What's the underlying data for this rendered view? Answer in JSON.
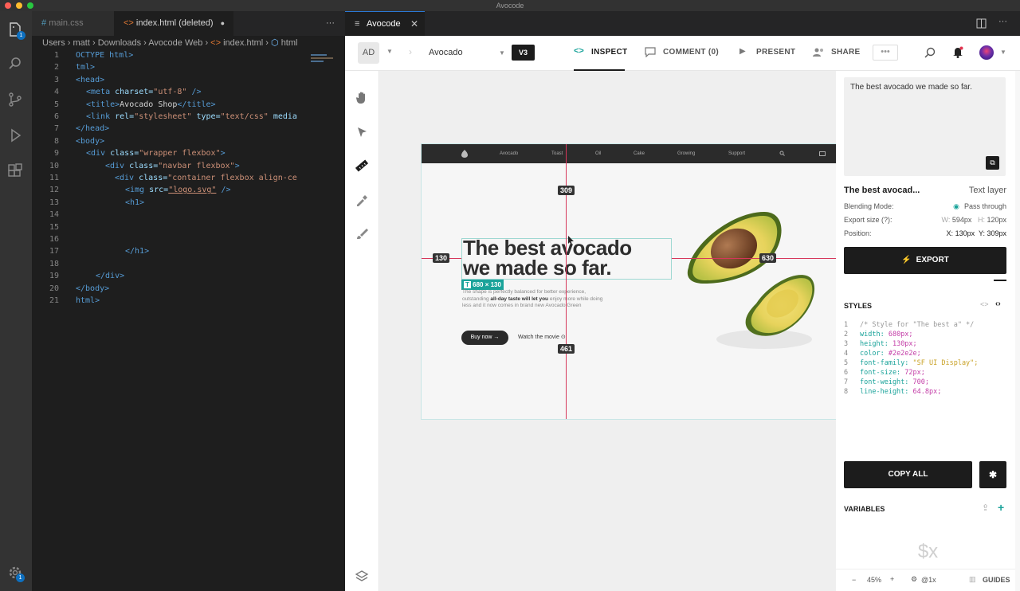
{
  "window": {
    "title": "Avocode"
  },
  "activity": {
    "explorer_badge": "1",
    "settings_badge": "1"
  },
  "editor": {
    "tabs": [
      {
        "label": "main.css"
      },
      {
        "label": "index.html (deleted)"
      }
    ],
    "more": "···",
    "breadcrumb": [
      "Users",
      "matt",
      "Downloads",
      "Avocode Web",
      "index.html",
      "html"
    ],
    "line_numbers": [
      "1",
      "2",
      "3",
      "4",
      "5",
      "6",
      "7",
      "8",
      "9",
      "10",
      "11",
      "12",
      "13",
      "14",
      "15",
      "16",
      "17",
      "18",
      "19",
      "20",
      "21"
    ],
    "code": {
      "l1": "OCTYPE html>",
      "l2": "tml>",
      "l3": "<head>",
      "l4_a": "<meta ",
      "l4_b": "charset=",
      "l4_c": "\"utf-8\"",
      "l4_d": " />",
      "l5_a": "<title>",
      "l5_b": "Avocado Shop",
      "l5_c": "</title>",
      "l6_a": "<link ",
      "l6_b": "rel=",
      "l6_c": "\"stylesheet\"",
      "l6_d": " type=",
      "l6_e": "\"text/css\"",
      "l6_f": " media",
      "l7": "</head>",
      "l8": "<body>",
      "l9_a": "<div ",
      "l9_b": "class=",
      "l9_c": "\"wrapper flexbox\"",
      "l9_d": ">",
      "l10_a": "<div ",
      "l10_b": "class=",
      "l10_c": "\"navbar flexbox\"",
      "l10_d": ">",
      "l11_a": "<div ",
      "l11_b": "class=",
      "l11_c": "\"container flexbox align-ce",
      "l12_a": "<img ",
      "l12_b": "src=",
      "l12_c": "\"logo.svg\"",
      "l12_d": " />",
      "l13": "<h1>",
      "l16": "</h1>",
      "l18": "</div>",
      "l19": "</body>",
      "l20": "html>"
    }
  },
  "app": {
    "tab_title": "Avocode",
    "toolbar": {
      "avatar_initials": "AD",
      "project": "Avocado",
      "version": "V3",
      "inspect": "INSPECT",
      "comment": "COMMENT (0)",
      "present": "PRESENT",
      "share": "SHARE"
    },
    "artboard": {
      "nav": [
        "Avocado",
        "Toast",
        "Oil",
        "Cake",
        "Growing",
        "Support"
      ],
      "headline1": "The best avocado",
      "headline2": "we made so far.",
      "size_badge": "680 × 130",
      "para1": "The shape is perfectly balanced for better experience,",
      "para2a": "outstanding ",
      "para2b": "all-day taste will let you",
      "para2c": " enjoy more while doing",
      "para3": "less and it now comes in brand new Avocado Green",
      "buy": "Buy now",
      "watch": "Watch the movie",
      "m_top": "309",
      "m_left": "130",
      "m_right": "630",
      "m_bottom": "461"
    },
    "panel": {
      "preview_text": "The best avocado we made so far.",
      "layer_name": "The best avocad...",
      "layer_type": "Text layer",
      "blending_label": "Blending Mode:",
      "blending_value": "Pass through",
      "export_label": "Export size (?):",
      "w_label": "W:",
      "w_value": "594px",
      "h_label": "H:",
      "h_value": "120px",
      "pos_label": "Position:",
      "x_label": "X:",
      "x_value": "130px",
      "y_label": "Y:",
      "y_value": "309px",
      "export_btn": "EXPORT",
      "styles_title": "STYLES",
      "style_lines": [
        {
          "n": "1",
          "a": "/* Style for \"The best a\" */",
          "b": ""
        },
        {
          "n": "2",
          "a": "width: ",
          "b": "680px;"
        },
        {
          "n": "3",
          "a": "height: ",
          "b": "130px;"
        },
        {
          "n": "4",
          "a": "color: ",
          "b": "#2e2e2e;"
        },
        {
          "n": "5",
          "a": "font-family: ",
          "b": "\"SF UI Display\";"
        },
        {
          "n": "6",
          "a": "font-size: ",
          "b": "72px;"
        },
        {
          "n": "7",
          "a": "font-weight: ",
          "b": "700;"
        },
        {
          "n": "8",
          "a": "line-height: ",
          "b": "64.8px;"
        }
      ],
      "copy_all": "COPY ALL",
      "variables": "VARIABLES",
      "variables_empty": "$x",
      "zoom": "45%",
      "scale": "@1x",
      "guides": "GUIDES"
    }
  },
  "colors": {
    "accent": "#1aa39a",
    "guide": "#d6375a",
    "dark": "#1c1c1c"
  }
}
